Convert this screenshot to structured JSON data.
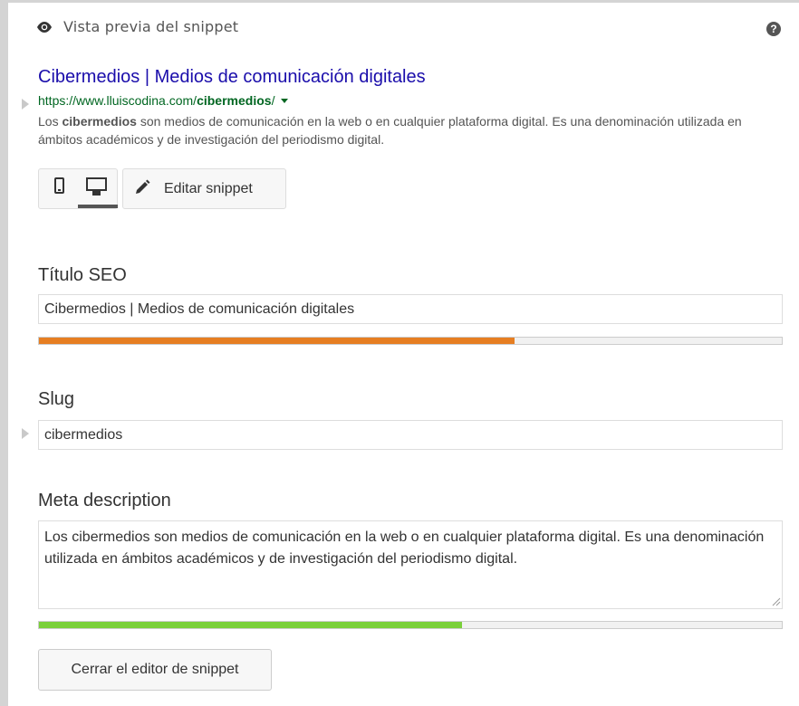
{
  "header": {
    "title": "Vista previa del snippet",
    "eye_icon": "eye-icon",
    "help_icon": "question-circle-icon",
    "help_glyph": "?"
  },
  "snippet_preview": {
    "title": "Cibermedios | Medios de comunicación digitales",
    "url_prefix": "https://www.lluiscodina.com/",
    "url_keyword": "cibermedios",
    "url_suffix": "/",
    "description_before": "Los ",
    "description_keyword": "cibermedios",
    "description_after": " son medios de comunicación en la web o en cualquier plataforma digital. Es una denominación utilizada en ámbitos académicos y de investigación del periodismo digital."
  },
  "mode_toggle": {
    "mobile_icon": "mobile-phone-icon",
    "desktop_icon": "desktop-monitor-icon",
    "active": "desktop"
  },
  "edit_button": {
    "label": "Editar snippet",
    "icon": "pencil-icon"
  },
  "fields": {
    "seo_title": {
      "label": "Título SEO",
      "value": "Cibermedios | Medios de comunicación digitales",
      "progress": 0.64,
      "progress_color": "#e67e22"
    },
    "slug": {
      "label": "Slug",
      "value": "cibermedios"
    },
    "meta_description": {
      "label": "Meta description",
      "value": "Los cibermedios son medios de comunicación en la web o en cualquier plataforma digital. Es una denominación utilizada en ámbitos académicos y de investigación del periodismo digital.",
      "progress": 0.57,
      "progress_color": "#7ad03a"
    }
  },
  "close_button": {
    "label": "Cerrar el editor de snippet"
  },
  "colors": {
    "link_title": "#1a0dab",
    "url_green": "#006621",
    "description_gray": "#545454"
  }
}
